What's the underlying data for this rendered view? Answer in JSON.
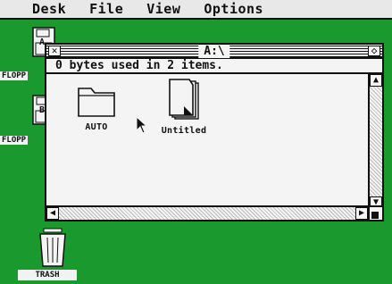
{
  "menubar": {
    "items": [
      "Desk",
      "File",
      "View",
      "Options"
    ]
  },
  "desktop": {
    "drives": [
      {
        "label": "FLOPP",
        "letter": "A"
      },
      {
        "label": "FLOPP",
        "letter": "B"
      }
    ],
    "trash": {
      "label": "TRASH"
    }
  },
  "window": {
    "title": "A:\\",
    "info": "0 bytes used in 2 items.",
    "files": [
      {
        "label": "AUTO",
        "type": "folder"
      },
      {
        "label": "Untitled",
        "type": "document"
      }
    ]
  },
  "colors": {
    "desktop": "#1a9a2e",
    "window": "#f4f4f4",
    "ink": "#111111"
  }
}
